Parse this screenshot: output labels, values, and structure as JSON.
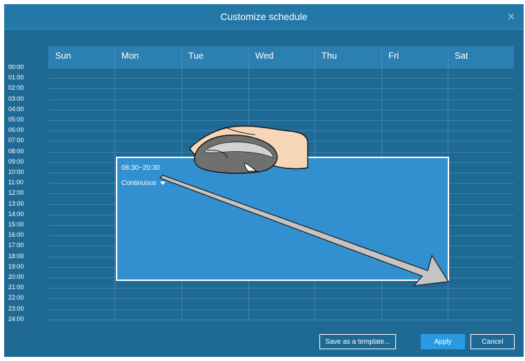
{
  "dialog": {
    "title": "Customize schedule",
    "close_icon": "×"
  },
  "days": [
    "Sun",
    "Mon",
    "Tue",
    "Wed",
    "Thu",
    "Fri",
    "Sat"
  ],
  "hours": [
    "00:00",
    "01:00",
    "02:00",
    "03:00",
    "04:00",
    "05:00",
    "06:00",
    "07:00",
    "08:00",
    "09:00",
    "10:00",
    "11:00",
    "12:00",
    "13:00",
    "14:00",
    "15:00",
    "16:00",
    "17:00",
    "18:00",
    "19:00",
    "20:00",
    "21:00",
    "22:00",
    "23:00",
    "24:00"
  ],
  "selection": {
    "time_range": "08:30~20:30",
    "mode": "Continuous"
  },
  "buttons": {
    "save_template": "Save as a template...",
    "apply": "Apply",
    "cancel": "Cancel"
  },
  "colors": {
    "background": "#1f6a95",
    "header": "#2b7fb1",
    "selection": "#3390d0",
    "apply": "#2a9be3"
  }
}
